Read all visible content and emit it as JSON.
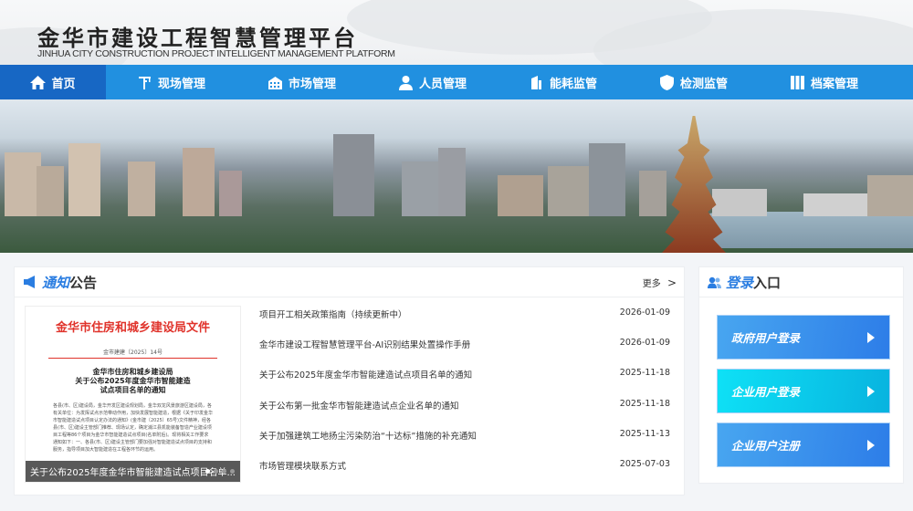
{
  "header": {
    "title": "金华市建设工程智慧管理平台",
    "subtitle": "JINHUA CITY CONSTRUCTION PROJECT INTELLIGENT MANAGEMENT PLATFORM"
  },
  "nav": [
    {
      "label": "首页",
      "icon": "home-icon",
      "active": true
    },
    {
      "label": "现场管理",
      "icon": "crane-icon"
    },
    {
      "label": "市场管理",
      "icon": "building-icon"
    },
    {
      "label": "人员管理",
      "icon": "person-icon"
    },
    {
      "label": "能耗监管",
      "icon": "energy-building-icon"
    },
    {
      "label": "检测监管",
      "icon": "shield-icon"
    },
    {
      "label": "档案管理",
      "icon": "archive-icon"
    }
  ],
  "notice": {
    "title_a": "通知",
    "title_b": "公告",
    "more": "更多",
    "doc": {
      "heading": "金华市住房和城乡建设局文件",
      "number": "金市建建〔2025〕14号",
      "title": "金华市住房和城乡建设局\n关于公布2025年度金华市智能建造\n试点项目名单的通知",
      "body": "各县(市、区)建设局，金华开发区建设规划局，金华双龙风景旅游区建设局，各有关单位：为发挥试点示范带动作用，加快发展智能建造，根据《关于印发金华市智能建造试点项目认定办法的通知》(金市建〔2025〕65号)文件精神，经各县(市、区)建设主管部门推荐、现场认定，确定浦江县凯能装备智造产业建设项目工程等86个项目为金华市智能建造试点项目(名单附后)。现将相关工作要求通知如下：一、各县(市、区)建设主管部门要加强对智能建造试点项目的支持和服务，指导项目加大智能建造在工程各环节的运用。"
    },
    "caption": "关于公布2025年度金华市智能建造试点项目名单...",
    "slides": 4,
    "active_slide": 1,
    "items": [
      {
        "title": "项目开工相关政策指南（持续更新中）",
        "date": "2026-01-09"
      },
      {
        "title": "金华市建设工程智慧管理平台-AI识别结果处置操作手册",
        "date": "2026-01-09"
      },
      {
        "title": "关于公布2025年度金华市智能建造试点项目名单的通知",
        "date": "2025-11-18"
      },
      {
        "title": "关于公布第一批金华市智能建造试点企业名单的通知",
        "date": "2025-11-18"
      },
      {
        "title": "关于加强建筑工地扬尘污染防治“十达标”措施的补充通知",
        "date": "2025-11-13"
      },
      {
        "title": "市场管理模块联系方式",
        "date": "2025-07-03"
      }
    ]
  },
  "login": {
    "title_a": "登录",
    "title_b": "入口",
    "buttons": [
      {
        "label": "政府用户登录",
        "style": "blue"
      },
      {
        "label": "企业用户登录",
        "style": "cyan"
      },
      {
        "label": "企业用户注册",
        "style": "blue"
      }
    ]
  },
  "colors": {
    "nav": "#2190e0",
    "nav_active": "#1767c4",
    "accent": "#2a7de1",
    "doc_red": "#e0332b"
  }
}
